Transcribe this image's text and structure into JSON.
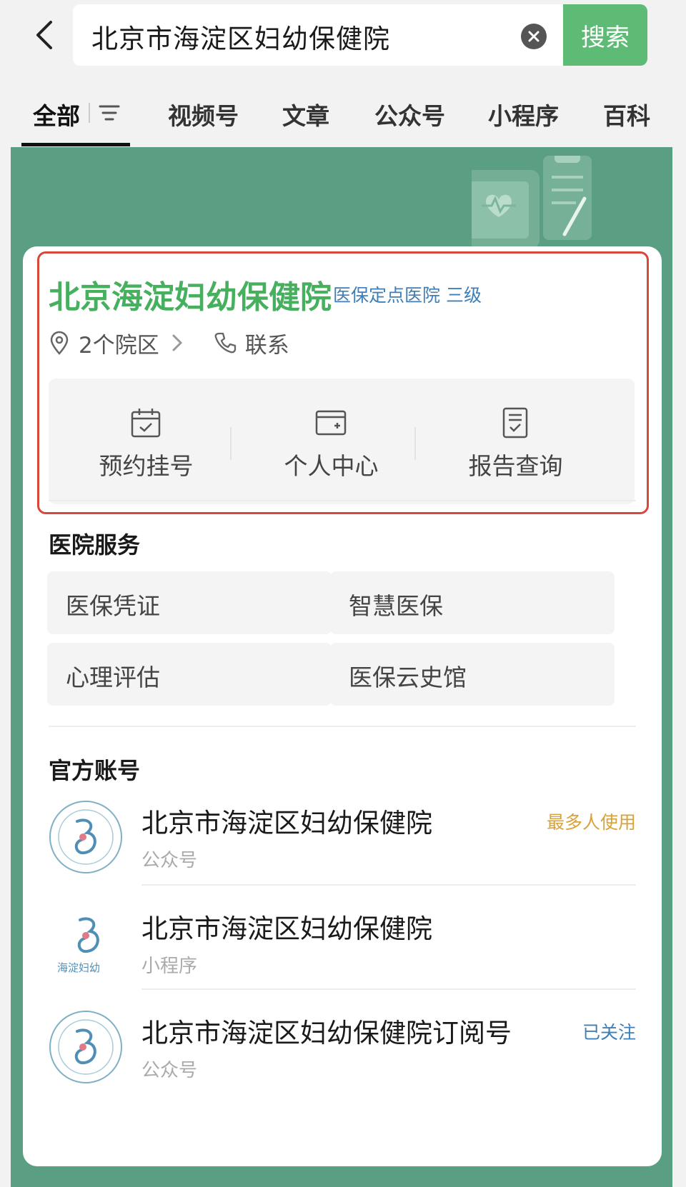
{
  "search": {
    "query": "北京市海淀区妇幼保健院",
    "button_label": "搜索"
  },
  "tabs": [
    {
      "label": "全部",
      "active": true
    },
    {
      "label": "视频号"
    },
    {
      "label": "文章"
    },
    {
      "label": "公众号"
    },
    {
      "label": "小程序"
    },
    {
      "label": "百科"
    }
  ],
  "hospital": {
    "name": "北京海淀妇幼保健院",
    "badge": "医保定点医院 三级",
    "campus": "2个院区",
    "contact": "联系",
    "quick_actions": [
      {
        "label": "预约挂号",
        "icon": "calendar-check-icon"
      },
      {
        "label": "个人中心",
        "icon": "card-plus-icon"
      },
      {
        "label": "报告查询",
        "icon": "report-icon"
      }
    ]
  },
  "services": {
    "title": "医院服务",
    "items": [
      "医保凭证",
      "智慧医保",
      "心理评估",
      "医保云史馆"
    ]
  },
  "accounts": {
    "title": "官方账号",
    "items": [
      {
        "name": "北京市海淀区妇幼保健院",
        "type": "公众号",
        "tag": "最多人使用",
        "tag_color": "#d9a13a"
      },
      {
        "name": "北京市海淀区妇幼保健院",
        "type": "小程序",
        "tag": "",
        "avatar_text": "海淀妇幼"
      },
      {
        "name": "北京市海淀区妇幼保健院订阅号",
        "type": "公众号",
        "tag": "已关注",
        "tag_color": "#3f7fb8"
      }
    ]
  },
  "colors": {
    "brand_green": "#5dbb75",
    "title_green": "#47b05f",
    "page_green": "#5a9f84",
    "highlight_red": "#d9463b",
    "link_blue": "#3f7fb8"
  }
}
